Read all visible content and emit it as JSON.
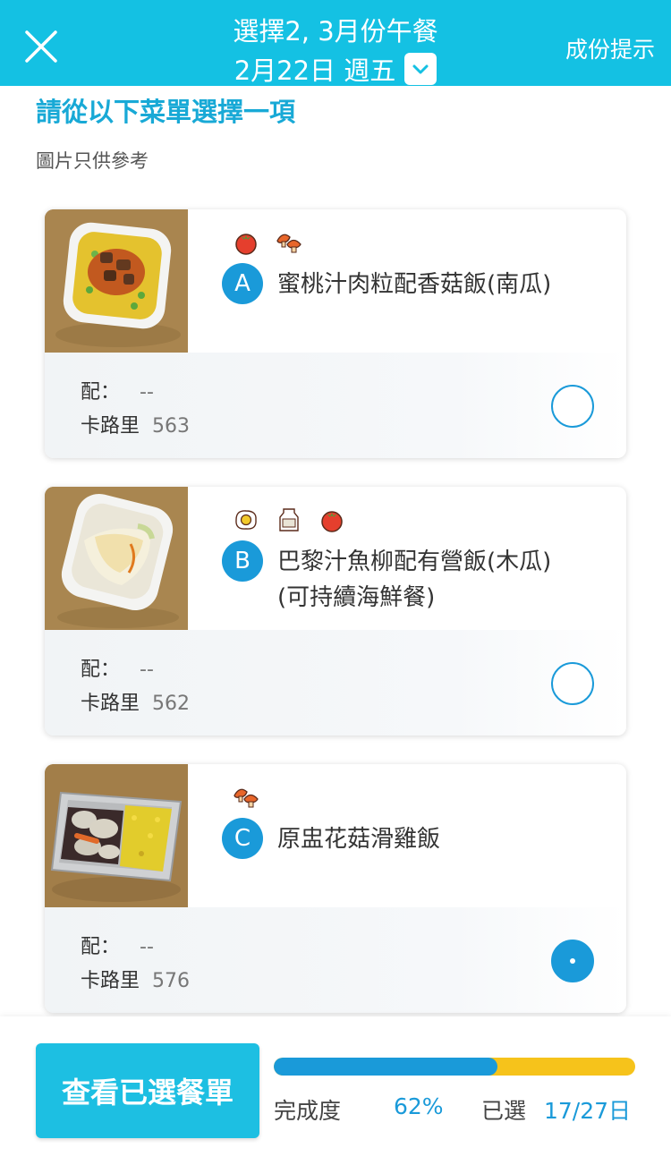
{
  "header": {
    "title": "選擇2, 3月份午餐",
    "date": "2月22日 週五",
    "hint_label": "成份提示",
    "close_icon": "close-icon",
    "dropdown_icon": "chevron-down-icon",
    "background_color": "#14c1e3"
  },
  "instruction": "請從以下菜單選擇一項",
  "reference_note": "圖片只供參考",
  "labels": {
    "side": "配：",
    "calories": "卡路里"
  },
  "options": [
    {
      "letter": "A",
      "name_line1": "蜜桃汁肉粒配香菇飯(南瓜)",
      "name_line2": "",
      "side": "--",
      "calories": "563",
      "icons": [
        "tomato-icon",
        "mushroom-icon"
      ],
      "selected": false
    },
    {
      "letter": "B",
      "name_line1": "巴黎汁魚柳配有營飯(木瓜)",
      "name_line2": "(可持續海鮮餐)",
      "side": "--",
      "calories": "562",
      "icons": [
        "egg-icon",
        "milk-icon",
        "tomato-icon"
      ],
      "selected": false
    },
    {
      "letter": "C",
      "name_line1": "原盅花菇滑雞飯",
      "name_line2": "",
      "side": "--",
      "calories": "576",
      "icons": [
        "mushroom-icon"
      ],
      "selected": true
    }
  ],
  "footer": {
    "view_button": "查看已選餐單",
    "progress_label": "完成度",
    "progress_percent": "62%",
    "progress_value": 0.62,
    "selected_label": "已選",
    "selected_value": "17/27日",
    "progress_fill_color": "#1a9ad9",
    "progress_track_color": "#f6c31b"
  }
}
